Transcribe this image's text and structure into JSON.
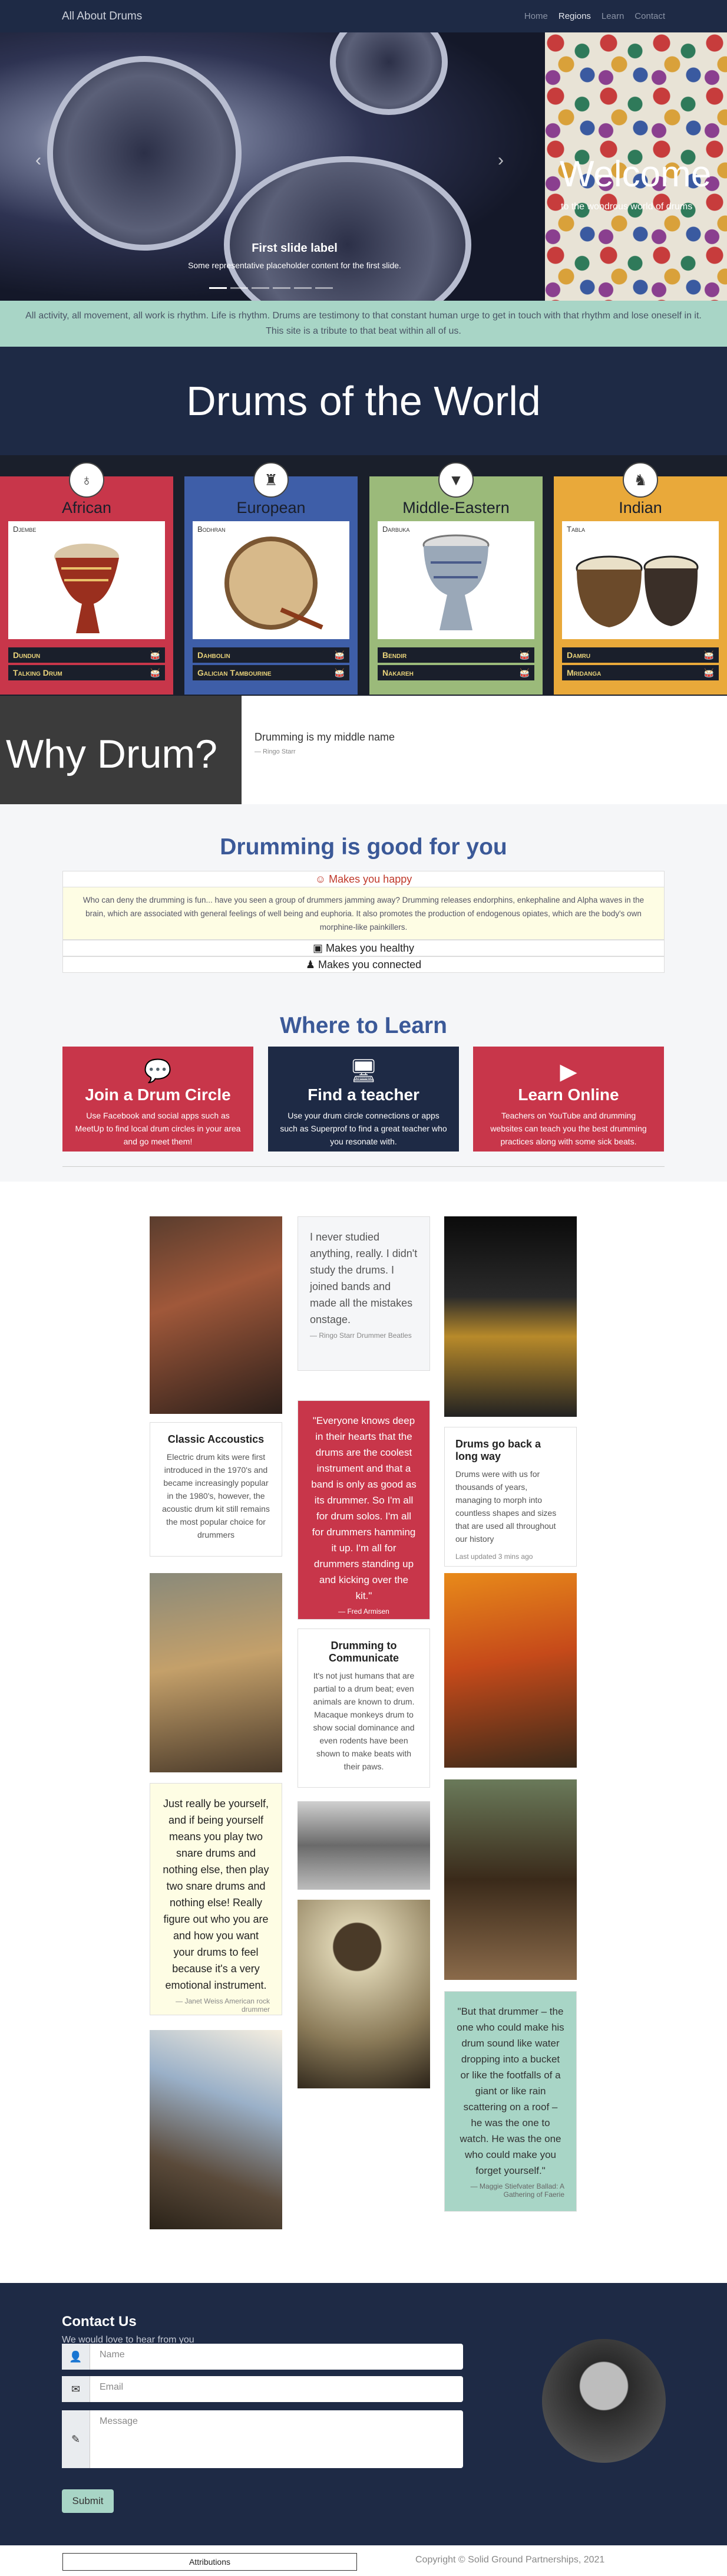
{
  "nav": {
    "brand": "All About Drums",
    "links": [
      "Home",
      "Regions",
      "Learn",
      "Contact"
    ],
    "active": "Regions"
  },
  "hero": {
    "slide_title": "First slide label",
    "slide_text": "Some representative placeholder content for the first slide.",
    "welcome": "Welcome",
    "welcome_sub": "to the wondrous world of drums",
    "prev": "‹",
    "next": "›",
    "indicators": 6
  },
  "quote_band": "All activity, all movement, all work is rhythm. Life is rhythm. Drums are testimony to that constant human urge to get in touch with that rhythm and lose oneself in it. This site is a tribute to that beat within all of us.",
  "page_title": "Drums of the World",
  "regions": [
    {
      "name": "African",
      "icon": "mask-icon",
      "glyph": "♁",
      "color": "#c8364a",
      "drum": "Djembe",
      "items": [
        {
          "name": "Dundun",
          "icon": "🥁"
        },
        {
          "name": "Talking Drum",
          "icon": "🥁"
        }
      ]
    },
    {
      "name": "European",
      "icon": "castle-icon",
      "glyph": "♜",
      "color": "#3e5ea8",
      "drum": "Bodhran",
      "items": [
        {
          "name": "Dahbolin",
          "icon": "🥁"
        },
        {
          "name": "Galician Tambourine",
          "icon": "🥁"
        }
      ]
    },
    {
      "name": "Middle-Eastern",
      "icon": "lamp-icon",
      "glyph": "▼",
      "color": "#9bba7a",
      "drum": "Darbuka",
      "items": [
        {
          "name": "Bendir",
          "icon": "🥁"
        },
        {
          "name": "Nakareh",
          "icon": "🥁"
        }
      ]
    },
    {
      "name": "Indian",
      "icon": "elephant-icon",
      "glyph": "♞",
      "color": "#e9a93a",
      "drum": "Tabla",
      "items": [
        {
          "name": "Damru",
          "icon": "🥁"
        },
        {
          "name": "Mridanga",
          "icon": "🥁"
        }
      ]
    }
  ],
  "why": {
    "title": "Why Drum?",
    "quote": "Drumming is my middle name",
    "cite": "— Ringo Starr"
  },
  "good": {
    "title": "Drumming is good for you",
    "items": [
      "Makes you happy",
      "Makes you healthy",
      "Makes you connected"
    ],
    "happy_text": "Who can deny the drumming is fun... have you seen a group of drummers jamming away? Drumming releases endorphins, enkephaline and Alpha waves in the brain, which are associated with general feelings of well being and euphoria. It also promotes the production of endogenous opiates, which are the body's own morphine-like painkillers."
  },
  "learn": {
    "title": "Where to Learn",
    "cards": [
      {
        "title": "Join a Drum Circle",
        "text": "Use Facebook and social apps such as MeetUp to find local drum circles in your area and go meet them!",
        "color": "#c8364a",
        "icon": "chat-icon",
        "glyph": "💬"
      },
      {
        "title": "Find a teacher",
        "text": "Use your drum circle connections or apps such as Superprof to find a great teacher who you resonate with.",
        "color": "#1e2a45",
        "icon": "teacher-icon",
        "glyph": "🖥"
      },
      {
        "title": "Learn Online",
        "text": "Teachers on YouTube and drumming websites can teach you the best drumming practices along with some sick beats.",
        "color": "#c8364a",
        "icon": "youtube-icon",
        "glyph": "▶"
      }
    ]
  },
  "mason": {
    "q_ringo": {
      "text": "I never studied anything, really. I didn't study the drums. I joined bands and made all the mistakes onstage.",
      "cite": "— Ringo Starr Drummer Beatles"
    },
    "c_classic": {
      "title": "Classic Accoustics",
      "text": "Electric drum kits were first introduced in the 1970's and became increasingly popular in the 1980's, however, the acoustic drum kit still remains the most popular choice for drummers"
    },
    "q_fred": {
      "text": "\"Everyone knows deep in their hearts that the drums are the coolest instrument and that a band is only as good as its drummer. So I'm all for drum solos. I'm all for drummers hamming it up. I'm all for drummers standing up and kicking over the kit.\"",
      "cite": "— Fred Armisen"
    },
    "c_back": {
      "title": "Drums go back a long way",
      "text": "Drums were with us for thousands of years, managing to morph into countless shapes and sizes that are used all throughout our history",
      "meta": "Last updated 3 mins ago"
    },
    "c_comm": {
      "title": "Drumming to Communicate",
      "text": "It's not just humans that are partial to a drum beat; even animals are known to drum. Macaque monkeys drum to show social dominance and even rodents have been shown to make beats with their paws."
    },
    "q_janet": {
      "text": "Just really be yourself, and if being yourself means you play two snare drums and nothing else, then play two snare drums and nothing else! Really figure out who you are and how you want your drums to feel because it's a very emotional instrument.",
      "cite": "— Janet Weiss American rock drummer"
    },
    "q_maggie": {
      "text": "\"But that drummer – the one who could make his drum sound like water dropping into a bucket or like the footfalls of a giant or like rain scattering on a roof – he was the one to watch. He was the one who could make you forget yourself.\"",
      "cite": "— Maggie Stiefvater Ballad: A Gathering of Faerie"
    }
  },
  "contact": {
    "title": "Contact Us",
    "subtitle": "We would love to hear from you",
    "name_placeholder": "Name",
    "email_placeholder": "Email",
    "message_placeholder": "Message",
    "submit": "Submit"
  },
  "footer": {
    "attributions": "Attributions",
    "copyright": "Copyright © Solid Ground Partnerships, 2021"
  }
}
